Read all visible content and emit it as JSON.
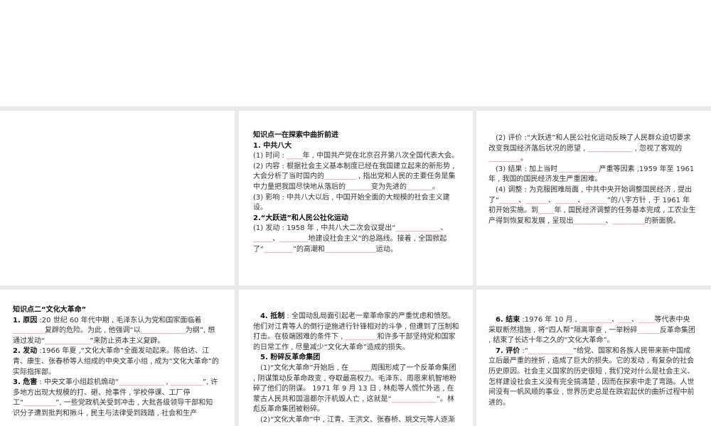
{
  "panels": [
    {
      "blocks": []
    },
    {
      "blocks": [
        {
          "type": "title",
          "segs": [
            "知识点一在探索中曲折前进"
          ]
        },
        {
          "type": "h",
          "segs": [
            "1. 中共八大"
          ]
        },
        {
          "type": "p",
          "segs": [
            "(1) 时间 : ",
            "_____",
            "年 , 中国共产党在北京召开第八次全国代表大会。"
          ]
        },
        {
          "type": "p",
          "segs": [
            "(2) 内容 : 根据社会主义基本制度已经在我国建立起来的新形势 , 大会分析了当时国内的",
            "__________",
            " , 指出党和人民的主要任务是集中力量把我国尽快地从落后的",
            "________",
            "变为先进的",
            "________",
            "。"
          ]
        },
        {
          "type": "p",
          "segs": [
            "(3) 影响 : 中共八大以后 , 中国开始全面的大规模的社会主义建设。"
          ]
        },
        {
          "type": "h",
          "segs": [
            "2.“大跃进”和人民公社化运动"
          ]
        },
        {
          "type": "p",
          "segs": [
            "(1) 发动 : 1958 年 , 中共八大二次会议提出“",
            "____",
            "__________",
            "、",
            "______",
            "、",
            "_________",
            "地建设社会主义”的总路线。接着 , 全国掀起了“",
            "_________",
            "”的高潮和",
            "________________",
            "运动。"
          ]
        }
      ]
    },
    {
      "blocks": [
        {
          "type": "p",
          "indent": true,
          "segs": [
            "(2) 评价 :“大跃进”和人民公社化运动反映了人民群众迫切要求改变我国经济落后状况的愿望 , ",
            "______________",
            " , 忽视了客观的",
            "__________",
            "。"
          ]
        },
        {
          "type": "p",
          "indent": true,
          "segs": [
            "(3) 结果 : 加上当时",
            "_____________",
            "严重等因素 ,1959 年至 1961 年 , 我国的国民经济发生严重困难。"
          ]
        },
        {
          "type": "p",
          "indent": true,
          "segs": [
            "(4) 调整 : 为克服困难局面 , 中共中央开始调整国民经济 , 提出了“",
            "______",
            "、",
            "_______",
            "、",
            "_______",
            "、",
            "_______",
            "”的八字方针 , 于 1961 年初开始实施。到",
            "_____",
            "年 , 国民经济调整的任务基本完成 , 工农业生产得到恢复和发展 , 呈现出",
            "__________",
            "、",
            "__________",
            "的新面貌。"
          ]
        }
      ]
    },
    {
      "blocks": [
        {
          "type": "title",
          "segs": [
            "知识点二“文化大革命”"
          ]
        },
        {
          "type": "p",
          "lead": "1. 原因",
          "segs": [
            " :20 世纪 60 年代中期 , 毛泽东认为党和国家面临着",
            "__________",
            "复辟的危险。为此 , 他强调“以",
            "______________",
            "为纲”, 想通过发动“",
            "______________",
            "”来防止资本主义复辟。"
          ]
        },
        {
          "type": "p",
          "lead": "2. 发动",
          "segs": [
            " :1966 年夏 ,“文化大革命”全面发动起来。陈伯达、江青、康生、张春桥等人组成的中央文革小组 , 成为“文化大革命”的实际指挥部。"
          ]
        },
        {
          "type": "p",
          "lead": "3. 危害",
          "segs": [
            " : 中央文革小组趁机煽动“",
            "______________",
            " , ",
            "__________",
            "”, 许多地方出现大规模的打、砸、抢事件 , 学校停课、工厂停工“",
            "__________",
            "”, 一些党政机关受到冲击 , 大批各级领导干部和知识分子遭到批判和揪斗 , 民主与法律受到践踏 , 社会和生产"
          ]
        }
      ]
    },
    {
      "blocks": [
        {
          "type": "p",
          "indent": true,
          "lead": "4. 抵制",
          "segs": [
            " : 全国动乱局面引起老一辈革命家的严重忧虑和愤怒。他们对江青等人的倒行逆施进行针锋相对的斗争 , 但遭到了压制和打击。在极端困难的条件下 , ",
            "__________",
            "和许多干部坚持党和国家的日常工作 , 尽量减少“文化大革命”造成的损失。"
          ]
        },
        {
          "type": "h",
          "indent": true,
          "segs": [
            "5. 粉碎反革命集团"
          ]
        },
        {
          "type": "p",
          "indent": true,
          "segs": [
            "(1)“文化大革命”开始后 , 在",
            "_______",
            "周围形成了一个反革命集团 , 阴谋策动反革命政变 , 夺取最高权力。毛泽东、周恩来机智地粉碎了他们的阴谋。 1971 年 9 月 13 日 , 林彪等人慌忙外逃 , 在蒙古人民共和国温都尔汗机毁人亡 , 这就是“",
            "______________",
            "”。林彪反革命集团被粉碎。"
          ]
        },
        {
          "type": "p",
          "indent": true,
          "segs": [
            "(2)“文化大革命”中 , 江青、王洪文、张春桥、姚文元等人逐渐"
          ]
        }
      ]
    },
    {
      "blocks": [
        {
          "type": "p",
          "indent": true,
          "lead": "6. 结束",
          "segs": [
            " :1976 年 10 月 , ",
            "__________",
            "、",
            "____",
            "、",
            "_____",
            "等代表中央采取断然措施 , 将“四人帮”隔离审查 , 一举粉碎",
            "_______",
            "反革命集团 , 结束了长达十年之久的“文化大革命”。"
          ]
        },
        {
          "type": "p",
          "indent": true,
          "lead": "7. 评价",
          "segs": [
            " :“",
            "______________",
            "”给党、国家和各族人民带来新中国成立后最严重的挫折 , 造成了巨大的损失。它的发动 , 有复杂的社会历史原因。社会主义国家的历史很短 , 我们党对什么是社会主义、怎样建设社会主义没有完全搞清楚 , 因而在探索中走了弯路。人世间没有一帆风顺的事业 , 世界历史总是在跌宕起伏的曲折过程中前进的。"
          ]
        }
      ]
    }
  ]
}
